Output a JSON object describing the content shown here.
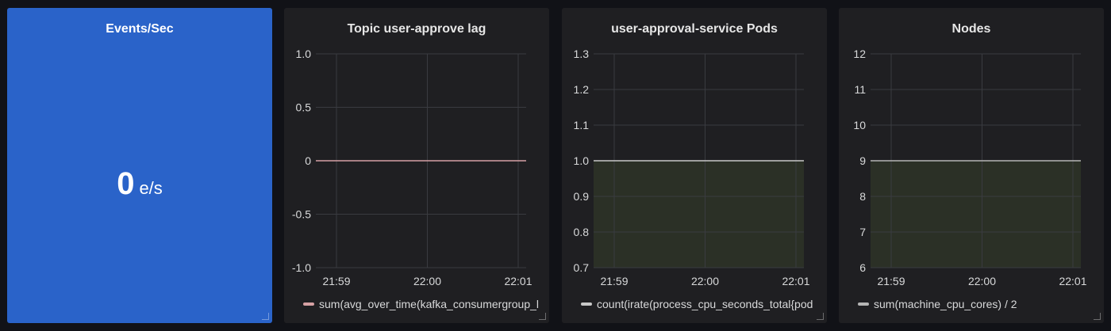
{
  "stat": {
    "title": "Events/Sec",
    "value": "0",
    "unit": "e/s",
    "color": "#2a63c9"
  },
  "panels": [
    {
      "title": "Topic user-approve lag",
      "legend": "sum(avg_over_time(kafka_consumergroup_l",
      "legend_color": "#d6a1a4",
      "resize_icon": "resize-corner-icon"
    },
    {
      "title": "user-approval-service Pods",
      "legend": "count(irate(process_cpu_seconds_total{pod",
      "legend_color": "#c8c8c8",
      "resize_icon": "resize-corner-icon"
    },
    {
      "title": "Nodes",
      "legend": "sum(machine_cpu_cores) / 2",
      "legend_color": "#b5b5b5",
      "resize_icon": "resize-corner-icon"
    }
  ],
  "chart_data": [
    {
      "type": "line",
      "title": "Topic user-approve lag",
      "x": [
        "21:59",
        "22:00",
        "22:01"
      ],
      "y_ticks": [
        "1.0",
        "0.5",
        "0",
        "-0.5",
        "-1.0"
      ],
      "ylim": [
        -1.0,
        1.0
      ],
      "grid": true,
      "series": [
        {
          "name": "sum(avg_over_time(kafka_consumergroup_l",
          "values": [
            0,
            0,
            0
          ],
          "color": "#d6a1a4",
          "fill": false
        }
      ],
      "legend": "bottom-left"
    },
    {
      "type": "area",
      "title": "user-approval-service Pods",
      "x": [
        "21:59",
        "22:00",
        "22:01"
      ],
      "y_ticks": [
        "1.3",
        "1.2",
        "1.1",
        "1.0",
        "0.9",
        "0.8",
        "0.7"
      ],
      "ylim": [
        0.7,
        1.3
      ],
      "grid": true,
      "series": [
        {
          "name": "count(irate(process_cpu_seconds_total{pod",
          "values": [
            1,
            1,
            1
          ],
          "color": "#c8c8c8",
          "fill": true
        }
      ],
      "legend": "bottom-left"
    },
    {
      "type": "area",
      "title": "Nodes",
      "x": [
        "21:59",
        "22:00",
        "22:01"
      ],
      "y_ticks": [
        "12",
        "11",
        "10",
        "9",
        "8",
        "7",
        "6"
      ],
      "ylim": [
        6,
        12
      ],
      "grid": true,
      "series": [
        {
          "name": "sum(machine_cpu_cores) / 2",
          "values": [
            9,
            9,
            9
          ],
          "color": "#b5b5b5",
          "fill": true
        }
      ],
      "legend": "bottom-left"
    }
  ]
}
